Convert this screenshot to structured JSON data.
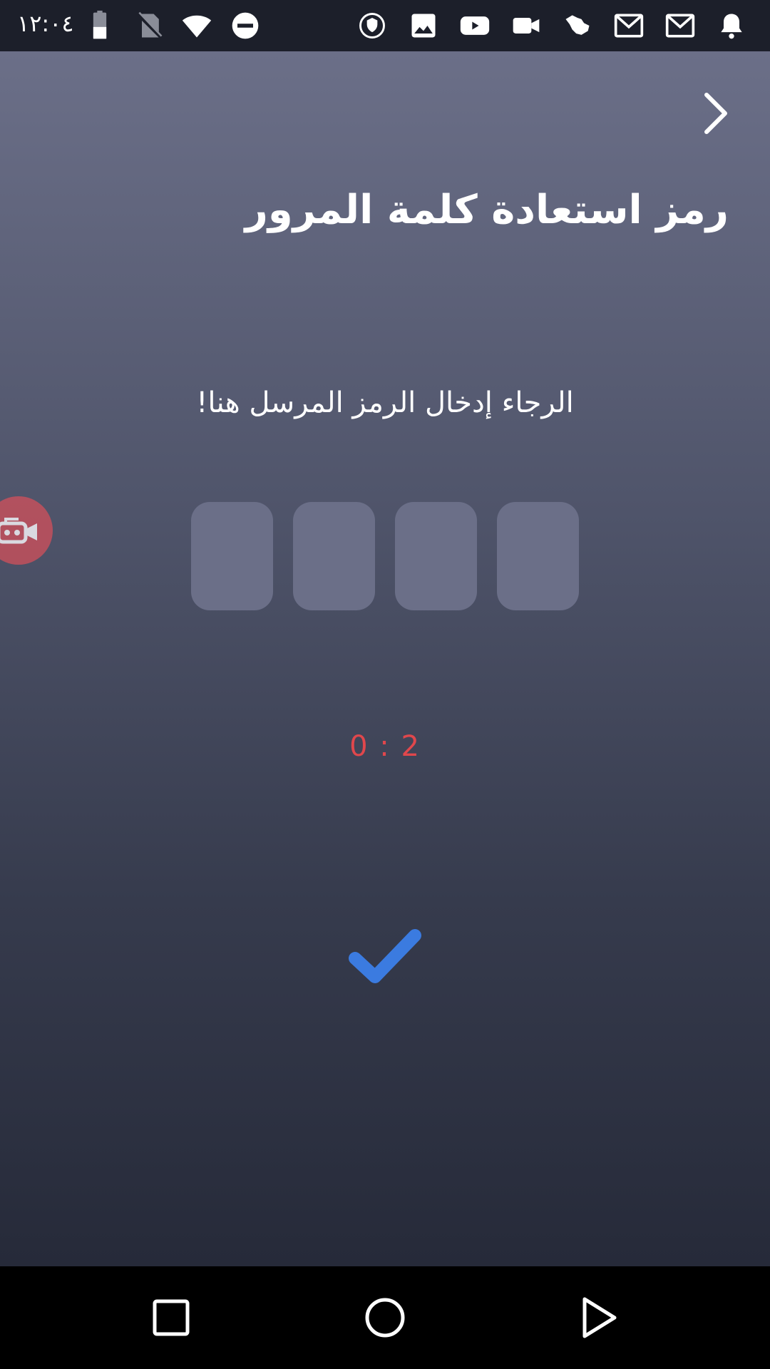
{
  "status_bar": {
    "time": "١٢:٠٤",
    "left_icons": [
      "battery-icon",
      "no-sim-icon",
      "wifi-icon",
      "do-not-disturb-icon"
    ],
    "right_icons": [
      "vpn-shield-icon",
      "image-icon",
      "youtube-icon",
      "video-camera-icon",
      "saudi-map-icon",
      "gmail-icon",
      "gmail-icon",
      "notification-bell-icon"
    ]
  },
  "header": {
    "back_icon": "chevron-right-icon",
    "title": "رمز استعادة كلمة المرور"
  },
  "main": {
    "instruction": "الرجاء إدخال الرمز المرسل هنا!",
    "code_inputs": [
      {
        "value": "",
        "placeholder": ""
      },
      {
        "value": "",
        "placeholder": ""
      },
      {
        "value": "",
        "placeholder": ""
      },
      {
        "value": "",
        "placeholder": ""
      }
    ],
    "timer": "0 : 2",
    "confirm_icon": "checkmark-icon"
  },
  "overlay": {
    "record_icon": "screen-recorder-icon"
  },
  "nav_bar": {
    "buttons": [
      "recents-square-icon",
      "home-circle-icon",
      "back-triangle-icon"
    ]
  },
  "colors": {
    "accent": "#3b7be0",
    "timer": "#e0474c",
    "input_box": "#6b6f88",
    "gradient_top": "#6b6f88",
    "gradient_bottom": "#262a39"
  }
}
